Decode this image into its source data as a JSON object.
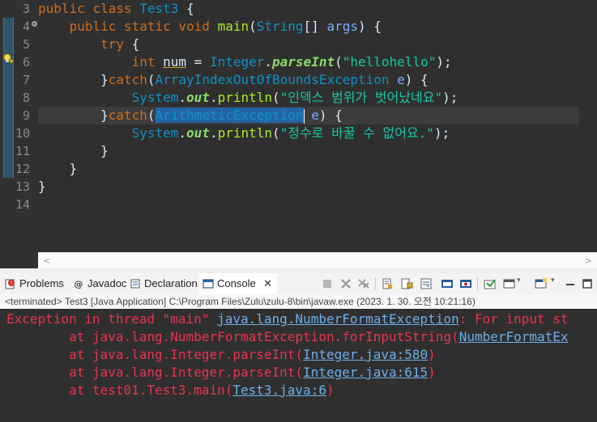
{
  "editor": {
    "line_numbers": [
      "3",
      "4",
      "5",
      "6",
      "7",
      "8",
      "9",
      "10",
      "11",
      "12",
      "13",
      "14"
    ],
    "lines": [
      [
        {
          "t": "public",
          "c": "kw"
        },
        {
          "t": " ",
          "c": "pl"
        },
        {
          "t": "class",
          "c": "kw"
        },
        {
          "t": " ",
          "c": "pl"
        },
        {
          "t": "Test3",
          "c": "tp"
        },
        {
          "t": " {",
          "c": "pl"
        }
      ],
      [
        {
          "t": "    ",
          "c": "pl"
        },
        {
          "t": "public",
          "c": "kw"
        },
        {
          "t": " ",
          "c": "pl"
        },
        {
          "t": "static",
          "c": "kw"
        },
        {
          "t": " ",
          "c": "pl"
        },
        {
          "t": "void",
          "c": "kw"
        },
        {
          "t": " ",
          "c": "pl"
        },
        {
          "t": "main",
          "c": "mt"
        },
        {
          "t": "(",
          "c": "pl"
        },
        {
          "t": "String",
          "c": "tp"
        },
        {
          "t": "[] ",
          "c": "pl"
        },
        {
          "t": "args",
          "c": "vr"
        },
        {
          "t": ") {",
          "c": "pl"
        }
      ],
      [
        {
          "t": "        ",
          "c": "pl"
        },
        {
          "t": "try",
          "c": "kw"
        },
        {
          "t": " {",
          "c": "pl"
        }
      ],
      [
        {
          "t": "            ",
          "c": "pl"
        },
        {
          "t": "int",
          "c": "kw"
        },
        {
          "t": " ",
          "c": "pl"
        },
        {
          "t": "num",
          "c": "pl uline"
        },
        {
          "t": " = ",
          "c": "pl"
        },
        {
          "t": "Integer",
          "c": "tp"
        },
        {
          "t": ".",
          "c": "pl"
        },
        {
          "t": "parseInt",
          "c": "fd"
        },
        {
          "t": "(",
          "c": "pl"
        },
        {
          "t": "\"hellohello\"",
          "c": "st"
        },
        {
          "t": ");",
          "c": "pl"
        }
      ],
      [
        {
          "t": "        }",
          "c": "pl"
        },
        {
          "t": "catch",
          "c": "kw"
        },
        {
          "t": "(",
          "c": "pl"
        },
        {
          "t": "ArrayIndexOutOfBoundsException",
          "c": "tp"
        },
        {
          "t": " ",
          "c": "pl"
        },
        {
          "t": "e",
          "c": "vr"
        },
        {
          "t": ") {",
          "c": "pl"
        }
      ],
      [
        {
          "t": "            ",
          "c": "pl"
        },
        {
          "t": "System",
          "c": "tp"
        },
        {
          "t": ".",
          "c": "pl"
        },
        {
          "t": "out",
          "c": "fd"
        },
        {
          "t": ".",
          "c": "pl"
        },
        {
          "t": "println",
          "c": "mt"
        },
        {
          "t": "(",
          "c": "pl"
        },
        {
          "t": "\"인덱스 범위가 벗어났네요\"",
          "c": "st"
        },
        {
          "t": ");",
          "c": "pl"
        }
      ],
      [
        {
          "t": "        }",
          "c": "pl"
        },
        {
          "t": "catch",
          "c": "kw"
        },
        {
          "t": "(",
          "c": "pl"
        },
        {
          "t": "ArithmeticException",
          "c": "sel"
        },
        {
          "t": "|",
          "c": "caret"
        },
        {
          "t": " ",
          "c": "pl"
        },
        {
          "t": "e",
          "c": "vr"
        },
        {
          "t": ") {",
          "c": "pl"
        }
      ],
      [
        {
          "t": "            ",
          "c": "pl"
        },
        {
          "t": "System",
          "c": "tp"
        },
        {
          "t": ".",
          "c": "pl"
        },
        {
          "t": "out",
          "c": "fd"
        },
        {
          "t": ".",
          "c": "pl"
        },
        {
          "t": "println",
          "c": "mt"
        },
        {
          "t": "(",
          "c": "pl"
        },
        {
          "t": "\"정수로 바꿀 수 없어요.\"",
          "c": "st"
        },
        {
          "t": ");",
          "c": "pl"
        }
      ],
      [
        {
          "t": "        }",
          "c": "pl"
        }
      ],
      [
        {
          "t": "    }",
          "c": "pl"
        }
      ],
      [
        {
          "t": "}",
          "c": "pl"
        }
      ],
      [
        {
          "t": "",
          "c": "pl"
        }
      ]
    ]
  },
  "tabs": {
    "problems": "Problems",
    "javadoc": "Javadoc",
    "declaration": "Declaration",
    "console": "Console",
    "close_glyph": "✕"
  },
  "console": {
    "status": "<terminated> Test3 [Java Application] C:\\Program Files\\Zulu\\zulu-8\\bin\\javaw.exe (2023. 1. 30. 오전 10:21:16)",
    "lines": [
      [
        {
          "t": "Exception in thread \"main\" ",
          "l": false
        },
        {
          "t": "java.lang.NumberFormatException",
          "l": true
        },
        {
          "t": ": For input st",
          "l": false
        }
      ],
      [
        {
          "t": "\tat java.lang.NumberFormatException.forInputString(",
          "l": false
        },
        {
          "t": "NumberFormatEx",
          "l": true
        }
      ],
      [
        {
          "t": "\tat java.lang.Integer.parseInt(",
          "l": false
        },
        {
          "t": "Integer.java:580",
          "l": true
        },
        {
          "t": ")",
          "l": false
        }
      ],
      [
        {
          "t": "\tat java.lang.Integer.parseInt(",
          "l": false
        },
        {
          "t": "Integer.java:615",
          "l": true
        },
        {
          "t": ")",
          "l": false
        }
      ],
      [
        {
          "t": "\tat test01.Test3.main(",
          "l": false
        },
        {
          "t": "Test3.java:6",
          "l": true
        },
        {
          "t": ")",
          "l": false
        }
      ]
    ]
  },
  "colors": {
    "editor_bg": "#2f2f2f",
    "keyword": "#cc6c1d",
    "type": "#1290c3",
    "string": "#17c6a3",
    "method": "#a7ec21",
    "error_text": "#e8344d",
    "link": "#6faee8"
  }
}
